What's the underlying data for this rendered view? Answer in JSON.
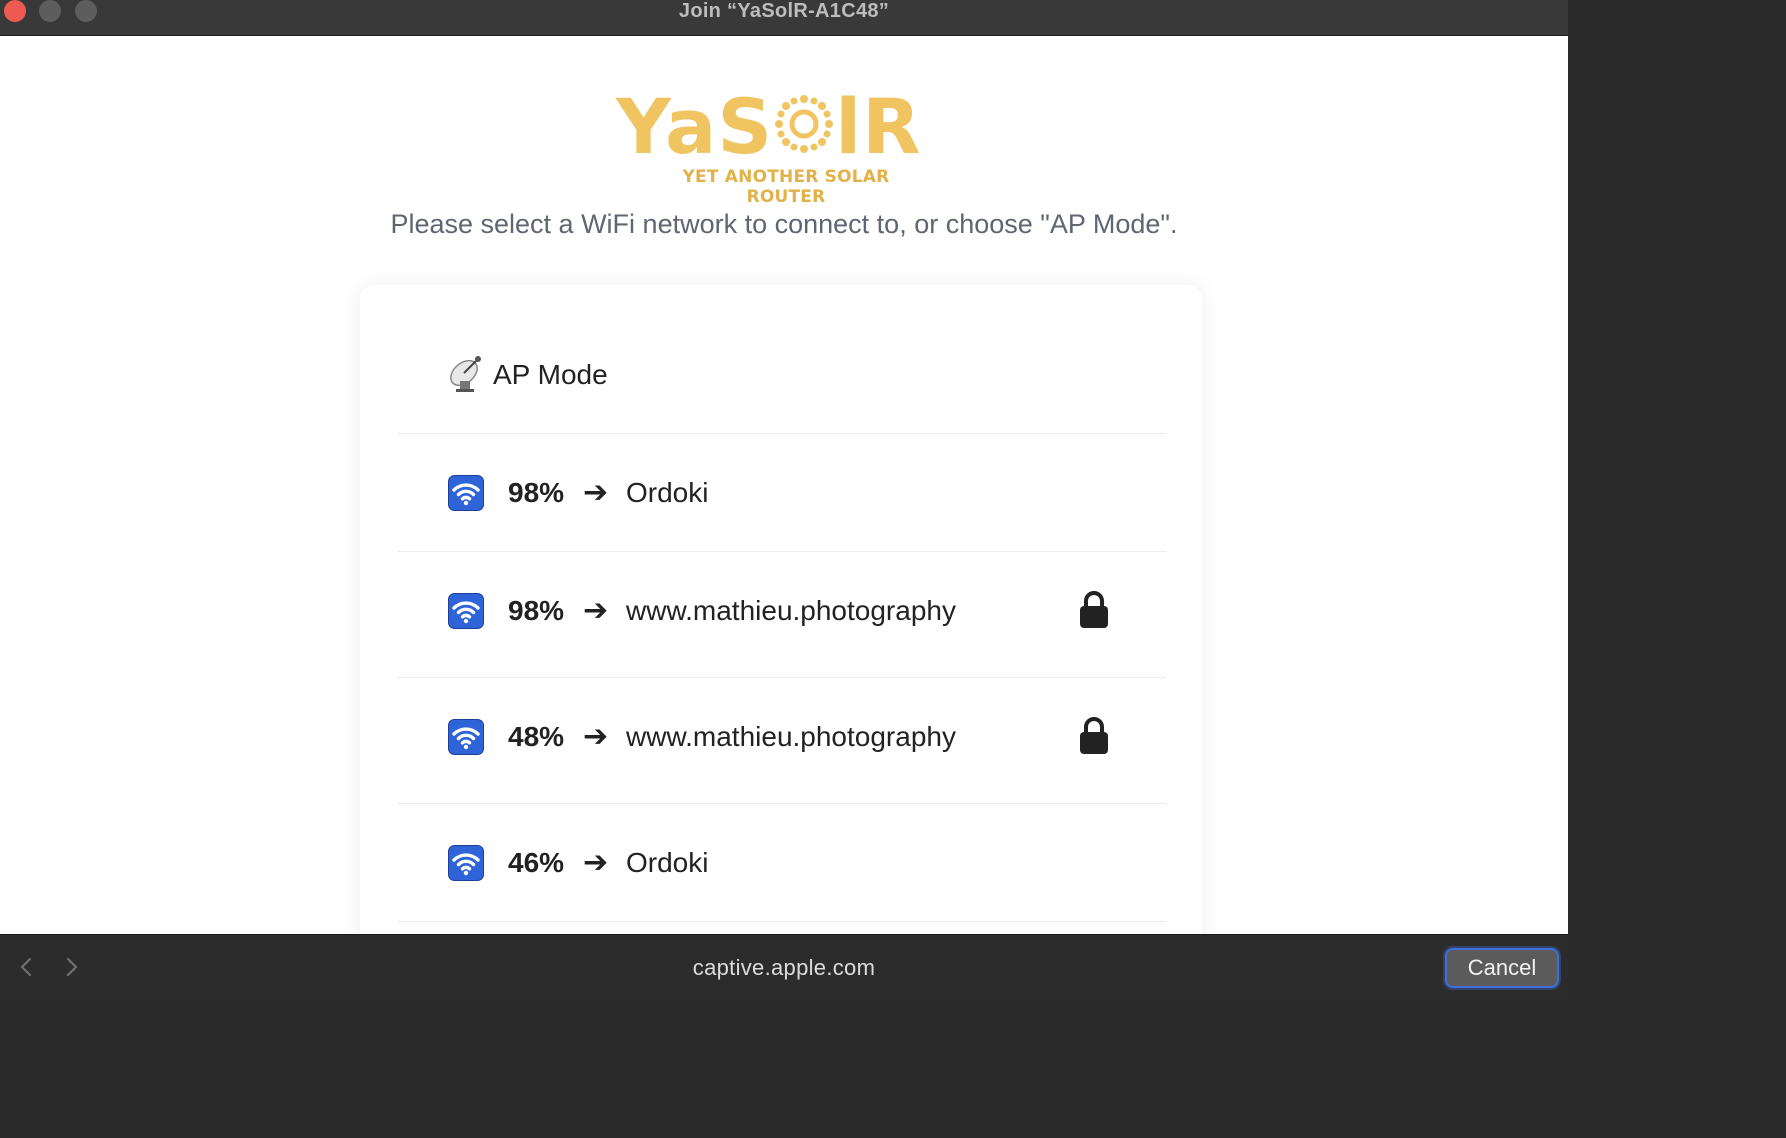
{
  "window": {
    "title": "Join “YaSolR-A1C48”"
  },
  "logo": {
    "main": "YaSolR",
    "tagline": "YET ANOTHER SOLAR ROUTER"
  },
  "instruction": "Please select a WiFi network to connect to, or choose \"AP Mode\".",
  "networks": [
    {
      "kind": "ap",
      "label": "AP Mode",
      "icon": "satellite-antenna-icon"
    },
    {
      "kind": "wifi",
      "signal": "98%",
      "arrow": "➔",
      "ssid": "Ordoki",
      "locked": false,
      "icon": "wifi-icon"
    },
    {
      "kind": "wifi",
      "signal": "98%",
      "arrow": "➔",
      "ssid": "www.mathieu.photography",
      "locked": true,
      "icon": "wifi-icon"
    },
    {
      "kind": "wifi",
      "signal": "48%",
      "arrow": "➔",
      "ssid": "www.mathieu.photography",
      "locked": true,
      "icon": "wifi-icon"
    },
    {
      "kind": "wifi",
      "signal": "46%",
      "arrow": "➔",
      "ssid": "Ordoki",
      "locked": false,
      "icon": "wifi-icon"
    }
  ],
  "bottombar": {
    "url": "captive.apple.com",
    "cancel_label": "Cancel"
  },
  "colors": {
    "logo": "#f0c460",
    "wifi_icon": "#2f64d8",
    "accent": "#3f6fd9"
  }
}
